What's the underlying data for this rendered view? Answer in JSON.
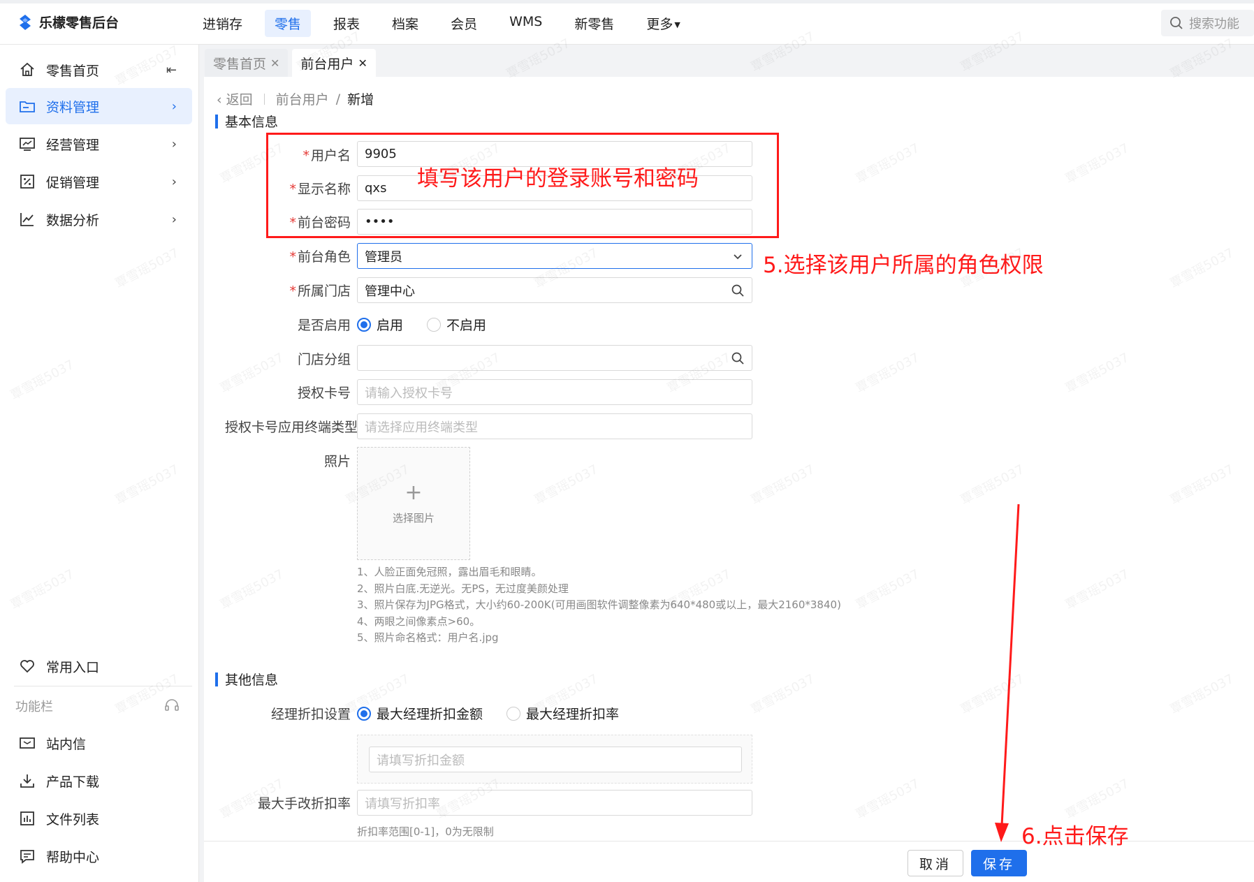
{
  "app": {
    "name": "乐檬零售后台"
  },
  "topnav": {
    "items": [
      {
        "label": "进销存"
      },
      {
        "label": "零售",
        "active": true
      },
      {
        "label": "报表"
      },
      {
        "label": "档案"
      },
      {
        "label": "会员"
      },
      {
        "label": "WMS"
      },
      {
        "label": "新零售"
      },
      {
        "label": "更多"
      }
    ],
    "search_placeholder": "搜索功能"
  },
  "sidebar": {
    "items": [
      {
        "label": "零售首页",
        "icon": "home-icon"
      },
      {
        "label": "资料管理",
        "icon": "folder-icon",
        "active": true
      },
      {
        "label": "经营管理",
        "icon": "monitor-chart-icon"
      },
      {
        "label": "促销管理",
        "icon": "promotion-icon"
      },
      {
        "label": "数据分析",
        "icon": "line-chart-icon"
      }
    ],
    "bottom": {
      "favorites_label": "常用入口",
      "toolbar_label": "功能栏",
      "items": [
        {
          "label": "站内信",
          "icon": "mail-icon"
        },
        {
          "label": "产品下载",
          "icon": "download-icon"
        },
        {
          "label": "文件列表",
          "icon": "file-list-icon"
        },
        {
          "label": "帮助中心",
          "icon": "help-chat-icon"
        }
      ]
    }
  },
  "tabs": [
    {
      "label": "零售首页",
      "active": false
    },
    {
      "label": "前台用户",
      "active": true
    }
  ],
  "breadcrumb": {
    "back": "返回",
    "parent": "前台用户",
    "separator": "/",
    "current": "新增"
  },
  "sections": {
    "basic": "基本信息",
    "other": "其他信息"
  },
  "form": {
    "username": {
      "label": "用户名",
      "value": "9905"
    },
    "display_name": {
      "label": "显示名称",
      "value": "qxs"
    },
    "password": {
      "label": "前台密码",
      "value": "••••"
    },
    "role": {
      "label": "前台角色",
      "value": "管理员"
    },
    "store": {
      "label": "所属门店",
      "value": "管理中心"
    },
    "enabled": {
      "label": "是否启用",
      "options": [
        "启用",
        "不启用"
      ],
      "selected": "启用"
    },
    "store_group": {
      "label": "门店分组",
      "value": ""
    },
    "auth_card": {
      "label": "授权卡号",
      "placeholder": "请输入授权卡号"
    },
    "auth_terminal": {
      "label": "授权卡号应用终端类型",
      "placeholder": "请选择应用终端类型"
    },
    "photo": {
      "label": "照片",
      "upload_text": "选择图片"
    },
    "photo_notes": [
      "1、人脸正面免冠照，露出眉毛和眼睛。",
      "2、照片白底.无逆光。无PS，无过度美颜处理",
      "3、照片保存为JPG格式，大小约60-200K(可用画图软件调整像素为640*480或以上，最大2160*3840)",
      "4、两眼之间像素点>60。",
      "5、照片命名格式：用户名.jpg"
    ],
    "discount_setting": {
      "label": "经理折扣设置",
      "options": [
        "最大经理折扣金额",
        "最大经理折扣率"
      ],
      "selected": "最大经理折扣金额"
    },
    "discount_amount": {
      "placeholder": "请填写折扣金额"
    },
    "max_manual_discount": {
      "label": "最大手改折扣率",
      "placeholder": "请填写折扣率",
      "hint": "折扣率范围[0-1]，0为无限制"
    }
  },
  "footer": {
    "cancel": "取消",
    "save": "保存"
  },
  "annotations": {
    "box_text": "填写该用户的登录账号和密码",
    "role_text": "5.选择该用户所属的角色权限",
    "save_text": "6.点击保存"
  },
  "watermark": "覃雪瑶5037",
  "colors": {
    "accent": "#1f6feb",
    "annotation": "#ff1a1a",
    "required": "#e53935"
  }
}
